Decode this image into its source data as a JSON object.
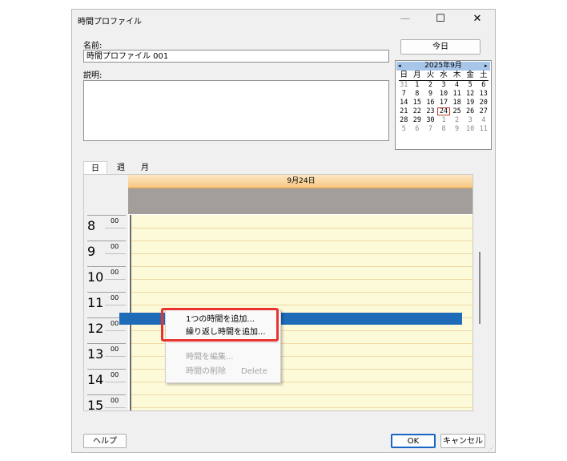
{
  "window": {
    "title": "時間プロファイル",
    "minimize_glyph": "—",
    "maximize_glyph": "☐",
    "close_glyph": "✕"
  },
  "form": {
    "name_label": "名前:",
    "name_value": "時間プロファイル 001",
    "description_label": "説明:",
    "description_value": ""
  },
  "calendar": {
    "today_button": "今日",
    "prev_glyph": "◂",
    "next_glyph": "▸",
    "month_label": "2025年9月",
    "weekdays": [
      "日",
      "月",
      "火",
      "水",
      "木",
      "金",
      "土"
    ],
    "weeks": [
      [
        "31",
        "1",
        "2",
        "3",
        "4",
        "5",
        "6"
      ],
      [
        "7",
        "8",
        "9",
        "10",
        "11",
        "12",
        "13"
      ],
      [
        "14",
        "15",
        "16",
        "17",
        "18",
        "19",
        "20"
      ],
      [
        "21",
        "22",
        "23",
        "24",
        "25",
        "26",
        "27"
      ],
      [
        "28",
        "29",
        "30",
        "1",
        "2",
        "3",
        "4"
      ],
      [
        "5",
        "6",
        "7",
        "8",
        "9",
        "10",
        "11"
      ]
    ],
    "today_day": "24"
  },
  "tabs": [
    {
      "label": "日"
    },
    {
      "label": "週"
    },
    {
      "label": "月"
    }
  ],
  "scheduler": {
    "day_header": "9月24日",
    "hours": [
      "8",
      "9",
      "10",
      "11",
      "12",
      "13",
      "14",
      "15"
    ],
    "minute_suffix": "00"
  },
  "context_menu": {
    "items": [
      {
        "label": "1つの時間を追加..."
      },
      {
        "label": "繰り返し時間を追加..."
      },
      {
        "label": "時間を編集..."
      },
      {
        "label": "時間の削除",
        "shortcut": "Delete"
      }
    ]
  },
  "footer": {
    "help_label": "ヘルプ",
    "ok_label": "OK",
    "cancel_label": "キャンセル"
  },
  "colors": {
    "selection": "#1e6bb8",
    "highlight_box": "#e8332f",
    "day_header": "#f7c780",
    "grid_background": "#fdfad9",
    "all_day": "#a19e9b"
  }
}
